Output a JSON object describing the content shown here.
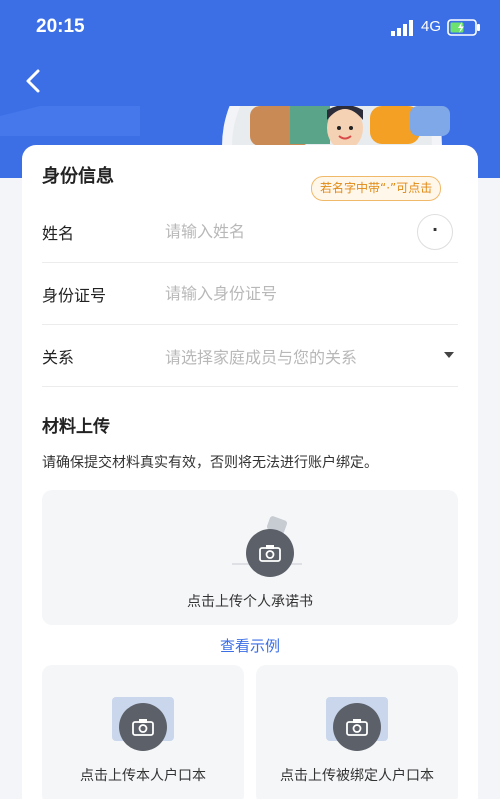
{
  "status_bar": {
    "time": "20:15",
    "network": "4G",
    "icons": [
      "signal-icon",
      "battery-icon"
    ]
  },
  "nav": {
    "back_icon": "back-arrow-icon"
  },
  "colors": {
    "primary": "#3c6fe6",
    "hint_border": "#f0b96a",
    "hint_text": "#e08a16",
    "placeholder": "#b8b8b8"
  },
  "identity": {
    "title": "身份信息",
    "hint": "若名字中带“·”可点击",
    "name": {
      "label": "姓名",
      "placeholder": "请输入姓名",
      "dot_button": "·"
    },
    "id_number": {
      "label": "身份证号",
      "placeholder": "请输入身份证号"
    },
    "relation": {
      "label": "关系",
      "placeholder": "请选择家庭成员与您的关系"
    }
  },
  "materials": {
    "title": "材料上传",
    "description": "请确保提交材料真实有效，否则将无法进行账户绑定。",
    "promise_upload": "点击上传个人承诺书",
    "view_example": "查看示例",
    "own_household_upload": "点击上传本人户口本",
    "bound_household_upload": "点击上传被绑定人户口本"
  }
}
